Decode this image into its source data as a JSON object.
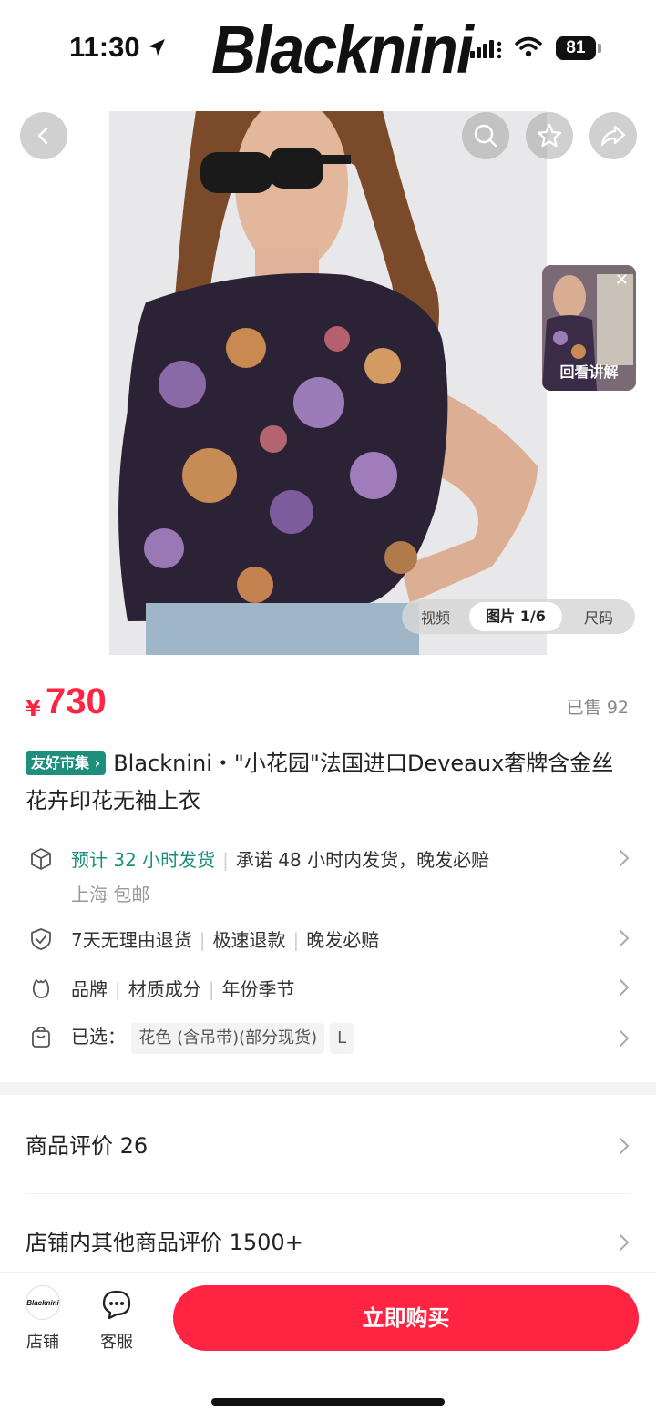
{
  "status_bar": {
    "time": "11:30",
    "battery": "81"
  },
  "brand": "Blacknini",
  "hero": {
    "live_label": "回看讲解",
    "media_tabs": {
      "video": "视频",
      "photos": "图片 1/6",
      "size": "尺码"
    }
  },
  "product": {
    "price_symbol": "¥",
    "price": "730",
    "sold": "已售 92",
    "tag": "友好市集",
    "title": "Blacknini・\"小花园\"法国进口Deveaux奢牌含金丝花卉印花无袖上衣"
  },
  "shipping": {
    "estimate": "预计 32 小时发货",
    "promise": "承诺 48 小时内发货，晚发必赔",
    "origin": "上海 包邮"
  },
  "guarantees": [
    "7天无理由退货",
    "极速退款",
    "晚发必赔"
  ],
  "attributes": [
    "品牌",
    "材质成分",
    "年份季节"
  ],
  "selection": {
    "label": "已选：",
    "options": [
      "花色 (含吊带)(部分现货)",
      "L"
    ]
  },
  "reviews": {
    "product_reviews": "商品评价 26",
    "store_reviews": "店铺内其他商品评价 1500+"
  },
  "bottom_bar": {
    "shop_logo_text": "Blacknini",
    "shop_label": "店铺",
    "service_label": "客服",
    "buy_label": "立即购买"
  },
  "colors": {
    "accent": "#ff2442",
    "tag_green": "#1d8f7c"
  },
  "icons": [
    "location-arrow-icon",
    "signal-icon",
    "wifi-icon",
    "battery-icon",
    "back-arrow-icon",
    "search-icon",
    "star-icon",
    "share-icon",
    "close-icon",
    "package-icon",
    "shield-icon",
    "brand-tag-icon",
    "bag-icon",
    "chevron-right-icon",
    "chat-icon"
  ]
}
